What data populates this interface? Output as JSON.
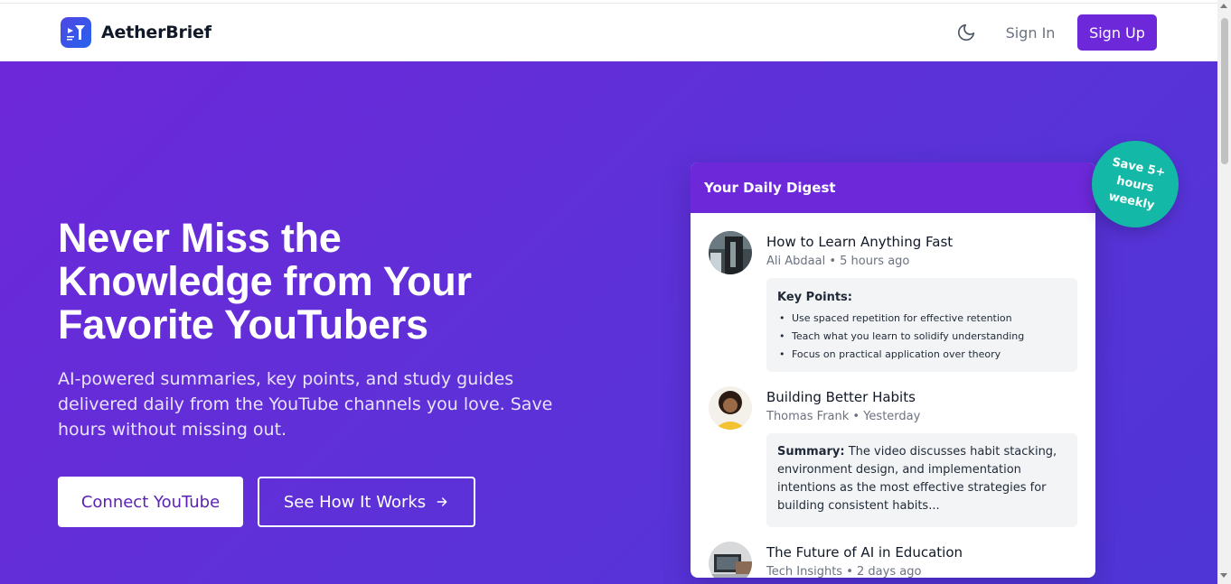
{
  "brand": {
    "name": "AetherBrief"
  },
  "nav": {
    "theme_icon": "moon-icon",
    "sign_in": "Sign In",
    "sign_up": "Sign Up"
  },
  "hero": {
    "headline_lines": [
      "Never Miss the",
      "Knowledge from Your",
      "Favorite YouTubers"
    ],
    "subtext": "AI-powered summaries, key points, and study guides delivered daily from the YouTube channels you love. Save hours without missing out.",
    "primary_button": "Connect YouTube",
    "secondary_button": "See How It Works",
    "secondary_icon": "arrow-right-icon"
  },
  "badge": {
    "lines": [
      "Save 5+",
      "hours",
      "weekly"
    ]
  },
  "digest": {
    "title": "Your Daily Digest",
    "items": [
      {
        "title": "How to Learn Anything Fast",
        "meta": "Ali Abdaal • 5 hours ago",
        "box_label": "Key Points:",
        "points": [
          "Use spaced repetition for effective retention",
          "Teach what you learn to solidify understanding",
          "Focus on practical application over theory"
        ]
      },
      {
        "title": "Building Better Habits",
        "meta": "Thomas Frank • Yesterday",
        "box_label": "Summary:",
        "summary": "The video discusses habit stacking, environment design, and implementation intentions as the most effective strategies for building consistent habits..."
      },
      {
        "title": "The Future of AI in Education",
        "meta": "Tech Insights • 2 days ago"
      }
    ]
  },
  "colors": {
    "brand_purple": "#6d28d9",
    "hero_gradient_start": "#6d28d9",
    "hero_gradient_end": "#4f35d6",
    "badge_teal": "#14b8a6"
  }
}
